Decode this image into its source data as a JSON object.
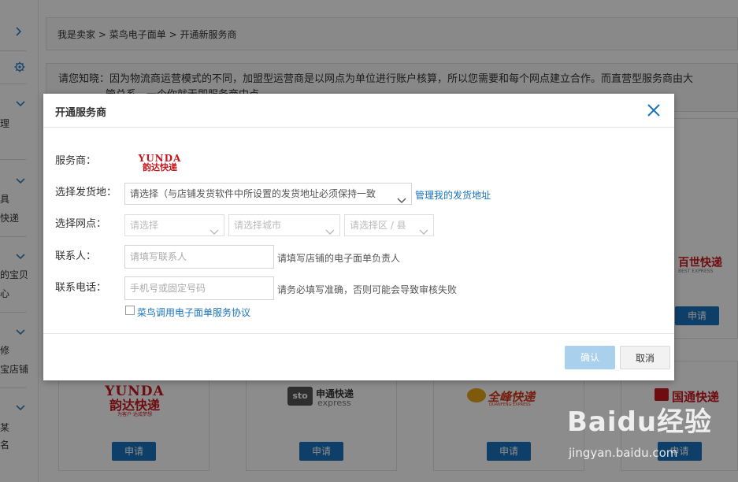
{
  "breadcrumb": {
    "part1": "我是卖家",
    "sep1": ">",
    "part2": "菜鸟电子面单",
    "sep2": ">",
    "part3": "开通新服务商"
  },
  "notice": {
    "line1": "请您知晓：因为物流商运营模式的不同，加盟型运营商是以网点为单位进行账户核算，所以您需要和每个网点建立合作。而直营型服务商由大",
    "line2": "管总系，一个你就无即服务商中点"
  },
  "sidebar": {
    "t1": "理",
    "t2": "具",
    "t3": "快递",
    "t4": "的宝贝",
    "t5": "心",
    "t6": "修",
    "t7": "宝店铺",
    "t8": "某",
    "t9": "名"
  },
  "cards": {
    "apply_label": "申请",
    "yunda_l1": "YUNDA",
    "yunda_l2": "韵达快递",
    "yunda_l3": "为客户·达成梦想",
    "sto_cn": "申通快递",
    "sto_en": "express",
    "sto_badge": "sto",
    "qf_cn": "全峰快递",
    "qf_en": "QUANFENG EXPRESS",
    "gt_cn": "国通快递",
    "bx_cn": "百世快递",
    "bx_en": "BEST EXPRESS"
  },
  "modal": {
    "title": "开通服务商",
    "provider_label": "服务商：",
    "provider_logo_l1": "YUNDA",
    "provider_logo_l2": "韵达快递",
    "address_label": "选择发货地：",
    "address_value": "请选择（与店铺发货软件中所设置的发货地址必须保持一致",
    "manage_link": "管理我的发货地址",
    "branch_label": "选择网点：",
    "branch_province": "请选择",
    "branch_city": "请选择城市",
    "branch_district": "请选择区 / 县",
    "contact_label": "联系人：",
    "contact_placeholder": "请填写联系人",
    "contact_hint": "请填写店铺的电子面单负责人",
    "phone_label": "联系电话：",
    "phone_placeholder": "手机号或固定号码",
    "phone_hint": "请务必填写准确，否则可能会导致审核失败",
    "agreement": "菜鸟调用电子面单服务协议",
    "confirm": "确认",
    "cancel": "取消"
  },
  "watermark": {
    "big": "Baidu经验",
    "small": "jingyan.baidu.com"
  },
  "colors": {
    "accent": "#1a74bd",
    "brand_red": "#c8161d",
    "confirm_disabled": "#a9d0ec"
  },
  "icons": {
    "close": "close-icon",
    "chevron": "chevron-down-icon",
    "gear": "gear-icon"
  }
}
